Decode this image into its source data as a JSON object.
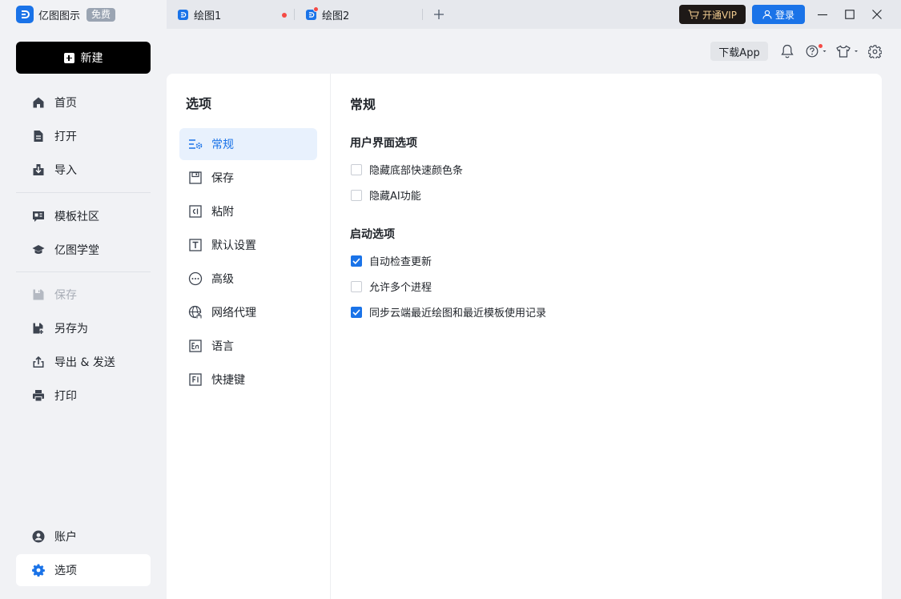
{
  "titlebar": {
    "app_name": "亿图图示",
    "free_badge": "免费",
    "tabs": [
      {
        "label": "绘图1",
        "unsaved": true
      },
      {
        "label": "绘图2",
        "unsaved": false
      }
    ],
    "vip_label": "开通VIP",
    "login_label": "登录"
  },
  "sidebar": {
    "new_label": "新建",
    "items": [
      {
        "label": "首页",
        "icon": "home-icon",
        "disabled": false
      },
      {
        "label": "打开",
        "icon": "file-open-icon",
        "disabled": false
      },
      {
        "label": "导入",
        "icon": "import-icon",
        "disabled": false
      },
      {
        "label": "模板社区",
        "icon": "template-community-icon",
        "disabled": false
      },
      {
        "label": "亿图学堂",
        "icon": "academy-icon",
        "disabled": false
      },
      {
        "label": "保存",
        "icon": "save-icon",
        "disabled": true
      },
      {
        "label": "另存为",
        "icon": "save-as-icon",
        "disabled": false
      },
      {
        "label": "导出 & 发送",
        "icon": "export-icon",
        "disabled": false
      },
      {
        "label": "打印",
        "icon": "print-icon",
        "disabled": false
      }
    ],
    "account_label": "账户",
    "options_label": "选项"
  },
  "toolbar": {
    "download_app": "下载App"
  },
  "options": {
    "title": "选项",
    "items": [
      {
        "label": "常规",
        "icon": "general-settings-icon",
        "active": true
      },
      {
        "label": "保存",
        "icon": "save-icon",
        "active": false
      },
      {
        "label": "粘附",
        "icon": "snap-icon",
        "active": false
      },
      {
        "label": "默认设置",
        "icon": "default-text-icon",
        "active": false
      },
      {
        "label": "高级",
        "icon": "more-icon",
        "active": false
      },
      {
        "label": "网络代理",
        "icon": "globe-icon",
        "active": false
      },
      {
        "label": "语言",
        "icon": "language-icon",
        "active": false
      },
      {
        "label": "快捷键",
        "icon": "shortcut-icon",
        "active": false
      }
    ]
  },
  "general": {
    "title": "常规",
    "ui_group": {
      "title": "用户界面选项",
      "items": [
        {
          "label": "隐藏底部快速颜色条",
          "checked": false
        },
        {
          "label": "隐藏AI功能",
          "checked": false
        }
      ]
    },
    "startup_group": {
      "title": "启动选项",
      "items": [
        {
          "label": "自动检查更新",
          "checked": true
        },
        {
          "label": "允许多个进程",
          "checked": false
        },
        {
          "label": "同步云端最近绘图和最近模板使用记录",
          "checked": true
        }
      ]
    }
  },
  "colors": {
    "accent": "#1a73e8",
    "vip_bg": "#1e1917",
    "vip_text": "#f1cb8f",
    "unsaved_dot": "#f54a45"
  }
}
